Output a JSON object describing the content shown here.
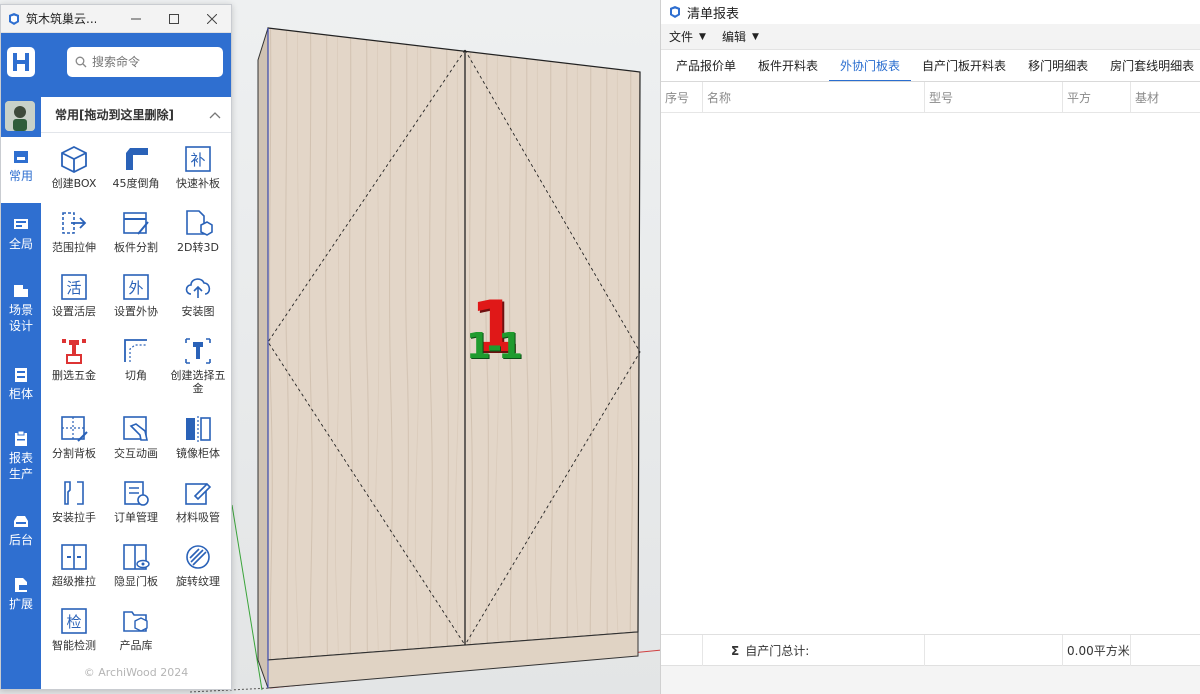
{
  "plugin": {
    "title": "筑木筑巢云...",
    "search": {
      "placeholder": "搜索命令"
    },
    "sidebar": [
      {
        "label": "常用",
        "icon": "common-icon",
        "active": true
      },
      {
        "label": "全局",
        "icon": "global-icon"
      },
      {
        "label": "场景设计",
        "icon": "scene-icon"
      },
      {
        "label": "柜体",
        "icon": "cabinet-icon"
      },
      {
        "label": "报表生产",
        "icon": "report-icon"
      },
      {
        "label": "后台",
        "icon": "backend-icon"
      },
      {
        "label": "扩展",
        "icon": "extend-icon"
      }
    ],
    "category_title": "常用[拖动到这里删除]",
    "tools": [
      {
        "label": "创建BOX",
        "icon": "box-icon"
      },
      {
        "label": "45度倒角",
        "icon": "bevel-icon"
      },
      {
        "label": "快速补板",
        "icon": "patch-board-icon",
        "glyph": "补"
      },
      {
        "label": "范围拉伸",
        "icon": "stretch-icon"
      },
      {
        "label": "板件分割",
        "icon": "split-board-icon"
      },
      {
        "label": "2D转3D",
        "icon": "2d-to-3d-icon"
      },
      {
        "label": "设置活层",
        "icon": "active-layer-icon",
        "glyph": "活"
      },
      {
        "label": "设置外协",
        "icon": "outsource-icon",
        "glyph": "外"
      },
      {
        "label": "安装图",
        "icon": "install-drawing-icon"
      },
      {
        "label": "删选五金",
        "icon": "filter-hardware-icon"
      },
      {
        "label": "切角",
        "icon": "cut-corner-icon"
      },
      {
        "label": "创建选择五金",
        "icon": "create-hardware-icon"
      },
      {
        "label": "分割背板",
        "icon": "split-back-icon"
      },
      {
        "label": "交互动画",
        "icon": "animation-icon"
      },
      {
        "label": "镜像柜体",
        "icon": "mirror-cabinet-icon"
      },
      {
        "label": "安装拉手",
        "icon": "handle-icon"
      },
      {
        "label": "订单管理",
        "icon": "order-icon"
      },
      {
        "label": "材料吸管",
        "icon": "eyedropper-icon"
      },
      {
        "label": "超级推拉",
        "icon": "push-pull-icon"
      },
      {
        "label": "隐显门板",
        "icon": "door-visibility-icon"
      },
      {
        "label": "旋转纹理",
        "icon": "rotate-texture-icon"
      },
      {
        "label": "智能检测",
        "icon": "inspect-icon",
        "glyph": "检"
      },
      {
        "label": "产品库",
        "icon": "product-library-icon"
      }
    ],
    "footer": "© ArchiWood 2024"
  },
  "viewport": {
    "label_big": "1",
    "label_small": "1-1",
    "colors": {
      "wood": "#e3d6c8",
      "label_red": "#e01818",
      "label_green": "#1f9b2e"
    }
  },
  "report": {
    "title": "清单报表",
    "menus": [
      "文件",
      "编辑"
    ],
    "tabs": [
      "产品报价单",
      "板件开料表",
      "外协门板表",
      "自产门板开料表",
      "移门明细表",
      "房门套线明细表"
    ],
    "active_tab": "外协门板表",
    "columns": [
      "序号",
      "名称",
      "型号",
      "平方",
      "基材"
    ],
    "footer_label": "自产门总计:",
    "footer_sum_symbol": "Σ",
    "footer_total": "0.00平方米"
  },
  "colors": {
    "accent": "#2f6fd0",
    "tab_active": "#2a6ecf"
  }
}
